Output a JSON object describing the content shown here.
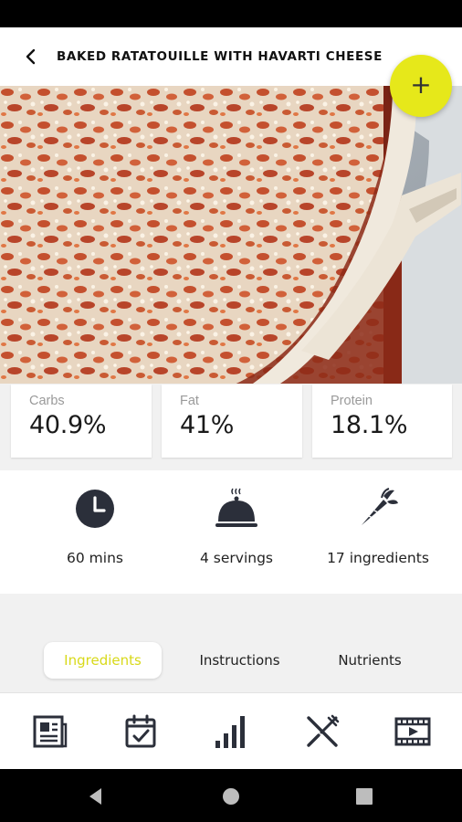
{
  "appbar": {
    "title": "BAKED RATATOUILLE WITH HAVARTI CHEESE",
    "back_icon": "chevron-left-icon"
  },
  "fab": {
    "label": "+",
    "icon": "plus-icon",
    "color": "#e6e81a"
  },
  "macros": [
    {
      "label": "Carbs",
      "value": "40.9%"
    },
    {
      "label": "Fat",
      "value": "41%"
    },
    {
      "label": "Protein",
      "value": "18.1%"
    }
  ],
  "stats": [
    {
      "icon": "clock-icon",
      "label": "60 mins"
    },
    {
      "icon": "serving-cloche-icon",
      "label": "4 servings"
    },
    {
      "icon": "carrot-icon",
      "label": "17 ingredients"
    }
  ],
  "tabs": [
    {
      "label": "Ingredients",
      "active": true
    },
    {
      "label": "Instructions",
      "active": false
    },
    {
      "label": "Nutrients",
      "active": false
    }
  ],
  "bottom_nav": [
    {
      "icon": "news-icon"
    },
    {
      "icon": "calendar-check-icon"
    },
    {
      "icon": "bar-chart-icon"
    },
    {
      "icon": "utensils-icon"
    },
    {
      "icon": "video-icon"
    }
  ],
  "colors": {
    "accent": "#e6e81a",
    "active_tab_text": "#d8d91a",
    "icon_dark": "#2b2f3a"
  }
}
